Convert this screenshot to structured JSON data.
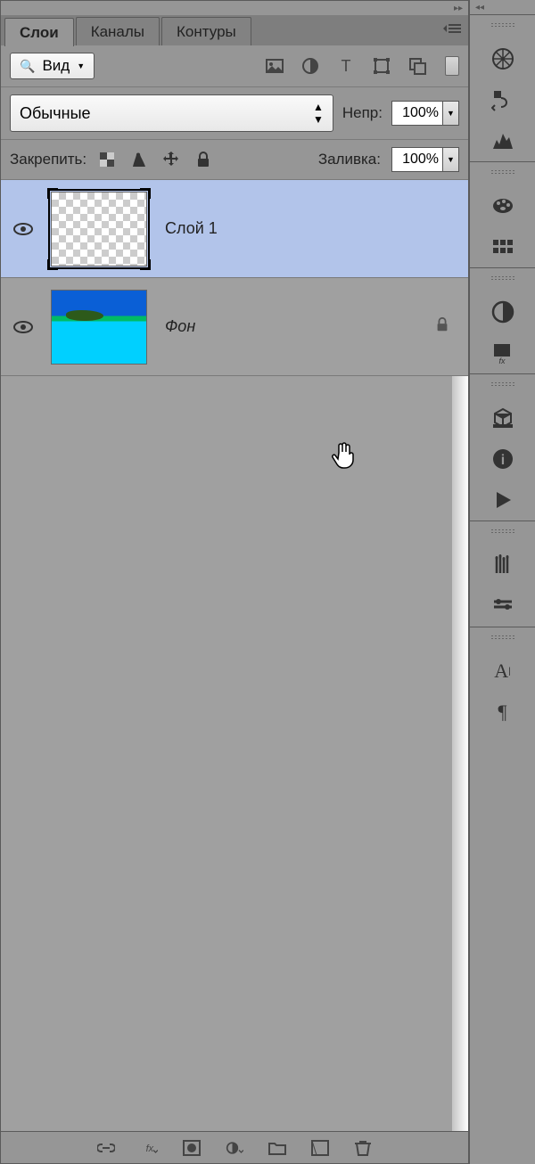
{
  "tabs": {
    "layers": "Слои",
    "channels": "Каналы",
    "paths": "Контуры"
  },
  "search": {
    "kind_label": "Вид"
  },
  "blend": {
    "mode": "Обычные",
    "opacity_label": "Непр:",
    "opacity_value": "100%"
  },
  "lock": {
    "label": "Закрепить:",
    "fill_label": "Заливка:",
    "fill_value": "100%"
  },
  "layers": [
    {
      "name": "Слой 1",
      "visible": true,
      "selected": true,
      "locked": false,
      "thumb": "transparent",
      "italic": false
    },
    {
      "name": "Фон",
      "visible": true,
      "selected": false,
      "locked": true,
      "thumb": "island",
      "italic": true
    }
  ],
  "dock_icons": [
    "navigator-icon",
    "history-icon",
    "histogram-icon",
    "color-icon",
    "swatches-icon",
    "adjustments-icon",
    "styles-icon",
    "3d-icon",
    "info-icon",
    "play-icon",
    "brushes-icon",
    "brush-presets-icon",
    "character-icon",
    "paragraph-icon"
  ],
  "bottom_icons": [
    "link-layers-icon",
    "layer-fx-icon",
    "add-mask-icon",
    "adjustment-layer-icon",
    "new-group-icon",
    "new-layer-icon",
    "delete-layer-icon"
  ]
}
